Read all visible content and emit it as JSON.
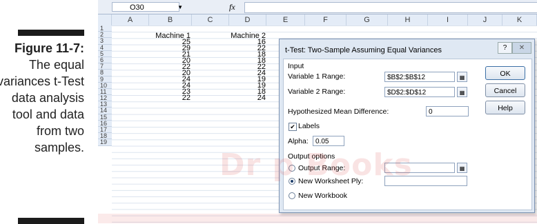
{
  "caption": {
    "figure_label": "Figure 11-7:",
    "text": "The equal variances t-Test data analysis tool and data from two samples."
  },
  "excel": {
    "namebox": "O30",
    "fx": "fx",
    "columns": [
      "A",
      "B",
      "C",
      "D",
      "E",
      "F",
      "G",
      "H",
      "I",
      "J",
      "K"
    ],
    "rows": [
      "1",
      "2",
      "3",
      "4",
      "5",
      "6",
      "7",
      "8",
      "9",
      "10",
      "11",
      "12",
      "13",
      "14",
      "15",
      "16",
      "17",
      "18",
      "19"
    ],
    "headers": {
      "b2": "Machine 1",
      "d2": "Machine 2"
    },
    "machine1": [
      "25",
      "29",
      "21",
      "20",
      "22",
      "20",
      "24",
      "24",
      "23",
      "22"
    ],
    "machine2": [
      "16",
      "22",
      "18",
      "18",
      "22",
      "24",
      "19",
      "19",
      "18",
      "24"
    ]
  },
  "dialog": {
    "title": "t-Test: Two-Sample Assuming Equal Variances",
    "help_label": "?",
    "close_label": "✕",
    "input_section": "Input",
    "var1_label": "Variable 1 Range:",
    "var1_value": "$B$2:$B$12",
    "var2_label": "Variable 2 Range:",
    "var2_value": "$D$2:$D$12",
    "hyp_label": "Hypothesized Mean Difference:",
    "hyp_value": "0",
    "labels_label": "Labels",
    "alpha_label": "Alpha:",
    "alpha_value": "0.05",
    "output_section": "Output options",
    "output_range_label": "Output Range:",
    "new_ply_label": "New Worksheet Ply:",
    "new_workbook_label": "New Workbook",
    "ok_label": "OK",
    "cancel_label": "Cancel",
    "help_button_label": "Help"
  },
  "watermark": "Dr  p  Books",
  "colors": {
    "header_bg": "#e4ecf7",
    "dialog_bg": "#dfe8f3"
  }
}
